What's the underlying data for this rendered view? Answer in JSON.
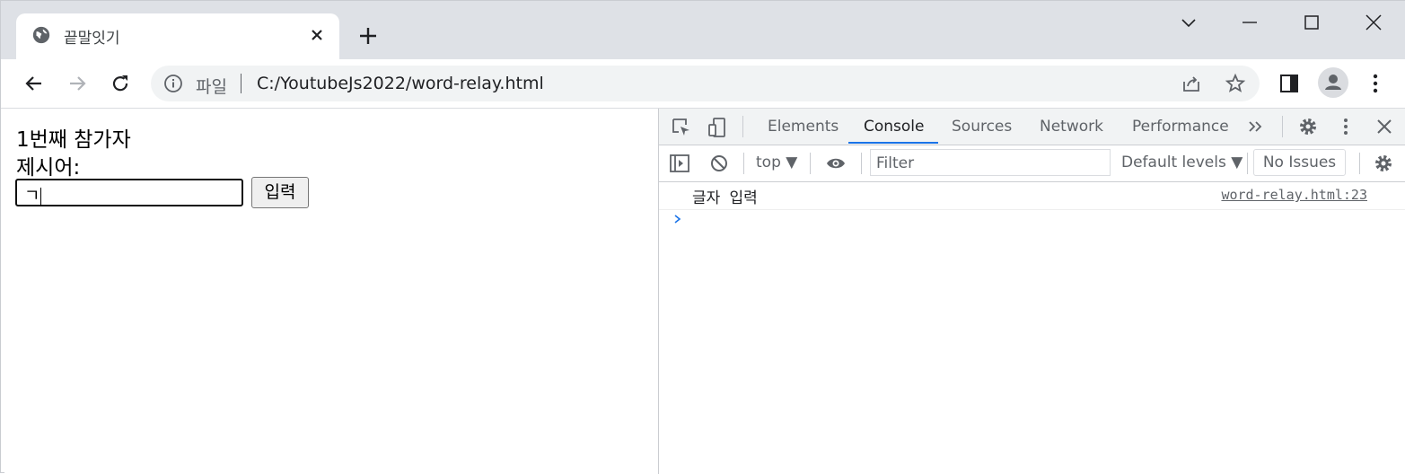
{
  "browser": {
    "tab_title": "끝말잇기",
    "url_scheme_label": "파일",
    "url": "C:/YoutubeJs2022/word-relay.html"
  },
  "page": {
    "participant_label": "1번째 참가자",
    "prompt_label": "제시어:",
    "input_value": "ㄱ",
    "submit_label": "입력"
  },
  "devtools": {
    "tabs": [
      "Elements",
      "Console",
      "Sources",
      "Network",
      "Performance"
    ],
    "active_tab": "Console",
    "context": "top",
    "filter_placeholder": "Filter",
    "levels_label": "Default levels",
    "issues_label": "No Issues",
    "log_message": "글자 입력",
    "log_source": "word-relay.html:23"
  },
  "colors": {
    "accent": "#1a73e8",
    "tabstrip": "#dee1e6"
  }
}
